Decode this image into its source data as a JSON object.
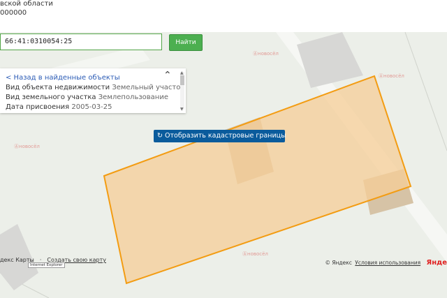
{
  "header": {
    "line1": "вской области",
    "line2": "000000"
  },
  "search": {
    "value": "66:41:0310054:25"
  },
  "find_button": {
    "label": "Найти"
  },
  "panel": {
    "back_link": "< Назад в найденные объекты",
    "rows": [
      {
        "label": "Вид объекта недвижимости",
        "value": "Земельный участок"
      },
      {
        "label": "Вид земельного участка",
        "value": "Землепользование"
      },
      {
        "label": "Дата присвоения",
        "value": "2005-03-25"
      }
    ]
  },
  "cadastral_button": {
    "label": "Отобразить кадастровые границы"
  },
  "watermark": {
    "text": "Ⓐновосёл"
  },
  "footer": {
    "left_prefix": "декс Карты",
    "create_map": "Создать свою карту",
    "ie_tooltip": "Internet Explorer",
    "copyright": "© Яндекс",
    "terms": "Условия использования",
    "logo": "Янде"
  },
  "colors": {
    "parcel_fill": "#f5cd97",
    "parcel_stroke": "#f39c12",
    "find_button": "#4caf50",
    "cadastral_button": "#0a5b9c"
  }
}
